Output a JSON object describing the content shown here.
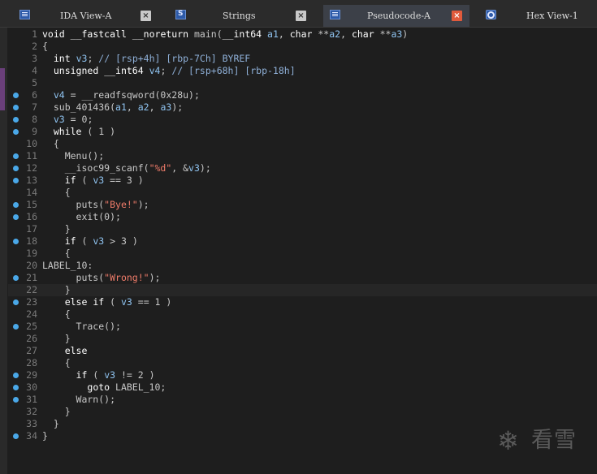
{
  "tabs": [
    {
      "label": "IDA View-A",
      "icon": "ida-view-icon",
      "active": false,
      "close": "×"
    },
    {
      "label": "Strings",
      "icon": "strings-icon",
      "active": false,
      "close": "×"
    },
    {
      "label": "Pseudocode-A",
      "icon": "pseudocode-icon",
      "active": true,
      "close": "×"
    },
    {
      "label": "Hex View-1",
      "icon": "hex-view-icon",
      "active": false
    }
  ],
  "code_lines": [
    {
      "n": "1",
      "bp": false,
      "text": "void __fastcall __noreturn main(__int64 a1, char **a2, char **a3)"
    },
    {
      "n": "2",
      "bp": false,
      "text": "{"
    },
    {
      "n": "3",
      "bp": false,
      "text": "  int v3; // [rsp+4h] [rbp-7Ch] BYREF"
    },
    {
      "n": "4",
      "bp": false,
      "text": "  unsigned __int64 v4; // [rsp+68h] [rbp-18h]"
    },
    {
      "n": "5",
      "bp": false,
      "text": ""
    },
    {
      "n": "6",
      "bp": true,
      "text": "  v4 = __readfsqword(0x28u);"
    },
    {
      "n": "7",
      "bp": true,
      "text": "  sub_401436(a1, a2, a3);"
    },
    {
      "n": "8",
      "bp": true,
      "text": "  v3 = 0;"
    },
    {
      "n": "9",
      "bp": true,
      "text": "  while ( 1 )"
    },
    {
      "n": "10",
      "bp": false,
      "text": "  {"
    },
    {
      "n": "11",
      "bp": true,
      "text": "    Menu();"
    },
    {
      "n": "12",
      "bp": true,
      "text": "    __isoc99_scanf(\"%d\", &v3);"
    },
    {
      "n": "13",
      "bp": true,
      "text": "    if ( v3 == 3 )"
    },
    {
      "n": "14",
      "bp": false,
      "text": "    {"
    },
    {
      "n": "15",
      "bp": true,
      "text": "      puts(\"Bye!\");"
    },
    {
      "n": "16",
      "bp": true,
      "text": "      exit(0);"
    },
    {
      "n": "17",
      "bp": false,
      "text": "    }"
    },
    {
      "n": "18",
      "bp": true,
      "text": "    if ( v3 > 3 )"
    },
    {
      "n": "19",
      "bp": false,
      "text": "    {"
    },
    {
      "n": "20",
      "bp": false,
      "text": "LABEL_10:"
    },
    {
      "n": "21",
      "bp": true,
      "text": "      puts(\"Wrong!\");"
    },
    {
      "n": "22",
      "bp": false,
      "text": "    }"
    },
    {
      "n": "23",
      "bp": true,
      "text": "    else if ( v3 == 1 )"
    },
    {
      "n": "24",
      "bp": false,
      "text": "    {"
    },
    {
      "n": "25",
      "bp": true,
      "text": "      Trace();"
    },
    {
      "n": "26",
      "bp": false,
      "text": "    }"
    },
    {
      "n": "27",
      "bp": false,
      "text": "    else"
    },
    {
      "n": "28",
      "bp": false,
      "text": "    {"
    },
    {
      "n": "29",
      "bp": true,
      "text": "      if ( v3 != 2 )"
    },
    {
      "n": "30",
      "bp": true,
      "text": "        goto LABEL_10;"
    },
    {
      "n": "31",
      "bp": true,
      "text": "      Warn();"
    },
    {
      "n": "32",
      "bp": false,
      "text": "    }"
    },
    {
      "n": "33",
      "bp": false,
      "text": "  }"
    },
    {
      "n": "34",
      "bp": true,
      "text": "}"
    }
  ],
  "watermark": {
    "glyph": "❄",
    "text": "看雪"
  },
  "colors": {
    "breakpoint": "#4aa8e8",
    "active_tab_close": "#e05a3c",
    "variable": "#8fc3f0",
    "string": "#f07c6a"
  }
}
